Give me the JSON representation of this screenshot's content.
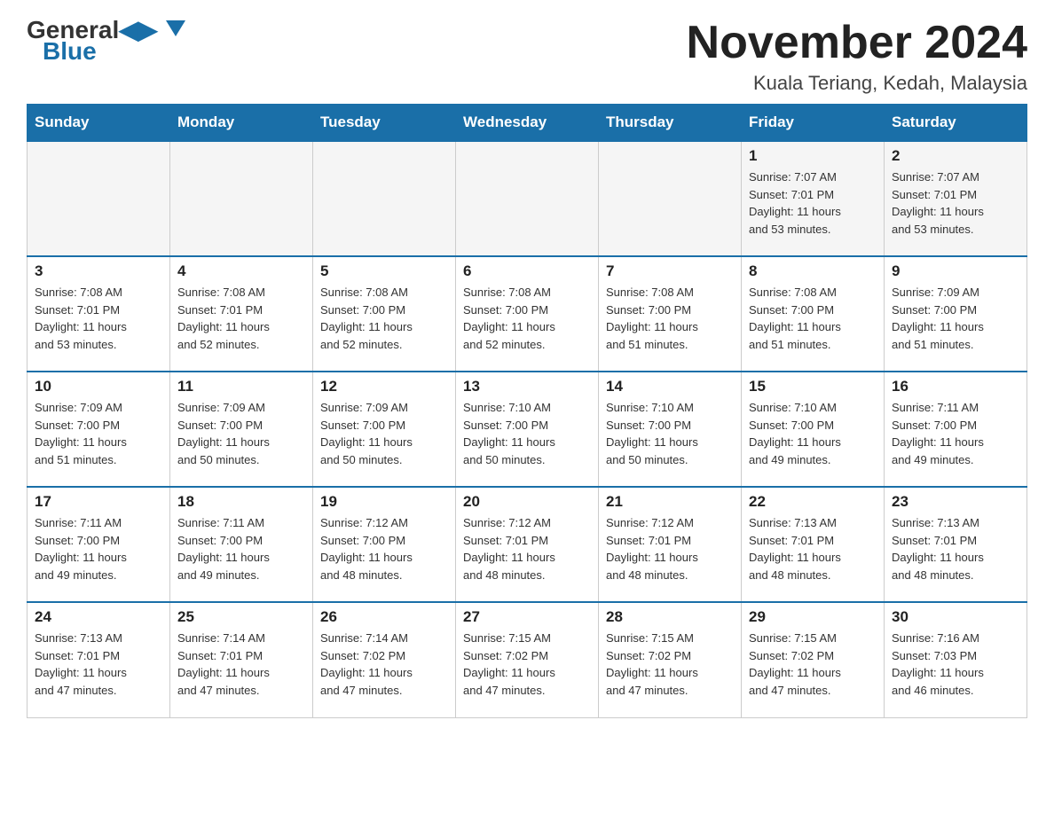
{
  "logo": {
    "general": "General",
    "blue": "Blue"
  },
  "title": "November 2024",
  "location": "Kuala Teriang, Kedah, Malaysia",
  "days_of_week": [
    "Sunday",
    "Monday",
    "Tuesday",
    "Wednesday",
    "Thursday",
    "Friday",
    "Saturday"
  ],
  "weeks": [
    [
      {
        "day": "",
        "info": ""
      },
      {
        "day": "",
        "info": ""
      },
      {
        "day": "",
        "info": ""
      },
      {
        "day": "",
        "info": ""
      },
      {
        "day": "",
        "info": ""
      },
      {
        "day": "1",
        "info": "Sunrise: 7:07 AM\nSunset: 7:01 PM\nDaylight: 11 hours\nand 53 minutes."
      },
      {
        "day": "2",
        "info": "Sunrise: 7:07 AM\nSunset: 7:01 PM\nDaylight: 11 hours\nand 53 minutes."
      }
    ],
    [
      {
        "day": "3",
        "info": "Sunrise: 7:08 AM\nSunset: 7:01 PM\nDaylight: 11 hours\nand 53 minutes."
      },
      {
        "day": "4",
        "info": "Sunrise: 7:08 AM\nSunset: 7:01 PM\nDaylight: 11 hours\nand 52 minutes."
      },
      {
        "day": "5",
        "info": "Sunrise: 7:08 AM\nSunset: 7:00 PM\nDaylight: 11 hours\nand 52 minutes."
      },
      {
        "day": "6",
        "info": "Sunrise: 7:08 AM\nSunset: 7:00 PM\nDaylight: 11 hours\nand 52 minutes."
      },
      {
        "day": "7",
        "info": "Sunrise: 7:08 AM\nSunset: 7:00 PM\nDaylight: 11 hours\nand 51 minutes."
      },
      {
        "day": "8",
        "info": "Sunrise: 7:08 AM\nSunset: 7:00 PM\nDaylight: 11 hours\nand 51 minutes."
      },
      {
        "day": "9",
        "info": "Sunrise: 7:09 AM\nSunset: 7:00 PM\nDaylight: 11 hours\nand 51 minutes."
      }
    ],
    [
      {
        "day": "10",
        "info": "Sunrise: 7:09 AM\nSunset: 7:00 PM\nDaylight: 11 hours\nand 51 minutes."
      },
      {
        "day": "11",
        "info": "Sunrise: 7:09 AM\nSunset: 7:00 PM\nDaylight: 11 hours\nand 50 minutes."
      },
      {
        "day": "12",
        "info": "Sunrise: 7:09 AM\nSunset: 7:00 PM\nDaylight: 11 hours\nand 50 minutes."
      },
      {
        "day": "13",
        "info": "Sunrise: 7:10 AM\nSunset: 7:00 PM\nDaylight: 11 hours\nand 50 minutes."
      },
      {
        "day": "14",
        "info": "Sunrise: 7:10 AM\nSunset: 7:00 PM\nDaylight: 11 hours\nand 50 minutes."
      },
      {
        "day": "15",
        "info": "Sunrise: 7:10 AM\nSunset: 7:00 PM\nDaylight: 11 hours\nand 49 minutes."
      },
      {
        "day": "16",
        "info": "Sunrise: 7:11 AM\nSunset: 7:00 PM\nDaylight: 11 hours\nand 49 minutes."
      }
    ],
    [
      {
        "day": "17",
        "info": "Sunrise: 7:11 AM\nSunset: 7:00 PM\nDaylight: 11 hours\nand 49 minutes."
      },
      {
        "day": "18",
        "info": "Sunrise: 7:11 AM\nSunset: 7:00 PM\nDaylight: 11 hours\nand 49 minutes."
      },
      {
        "day": "19",
        "info": "Sunrise: 7:12 AM\nSunset: 7:00 PM\nDaylight: 11 hours\nand 48 minutes."
      },
      {
        "day": "20",
        "info": "Sunrise: 7:12 AM\nSunset: 7:01 PM\nDaylight: 11 hours\nand 48 minutes."
      },
      {
        "day": "21",
        "info": "Sunrise: 7:12 AM\nSunset: 7:01 PM\nDaylight: 11 hours\nand 48 minutes."
      },
      {
        "day": "22",
        "info": "Sunrise: 7:13 AM\nSunset: 7:01 PM\nDaylight: 11 hours\nand 48 minutes."
      },
      {
        "day": "23",
        "info": "Sunrise: 7:13 AM\nSunset: 7:01 PM\nDaylight: 11 hours\nand 48 minutes."
      }
    ],
    [
      {
        "day": "24",
        "info": "Sunrise: 7:13 AM\nSunset: 7:01 PM\nDaylight: 11 hours\nand 47 minutes."
      },
      {
        "day": "25",
        "info": "Sunrise: 7:14 AM\nSunset: 7:01 PM\nDaylight: 11 hours\nand 47 minutes."
      },
      {
        "day": "26",
        "info": "Sunrise: 7:14 AM\nSunset: 7:02 PM\nDaylight: 11 hours\nand 47 minutes."
      },
      {
        "day": "27",
        "info": "Sunrise: 7:15 AM\nSunset: 7:02 PM\nDaylight: 11 hours\nand 47 minutes."
      },
      {
        "day": "28",
        "info": "Sunrise: 7:15 AM\nSunset: 7:02 PM\nDaylight: 11 hours\nand 47 minutes."
      },
      {
        "day": "29",
        "info": "Sunrise: 7:15 AM\nSunset: 7:02 PM\nDaylight: 11 hours\nand 47 minutes."
      },
      {
        "day": "30",
        "info": "Sunrise: 7:16 AM\nSunset: 7:03 PM\nDaylight: 11 hours\nand 46 minutes."
      }
    ]
  ]
}
